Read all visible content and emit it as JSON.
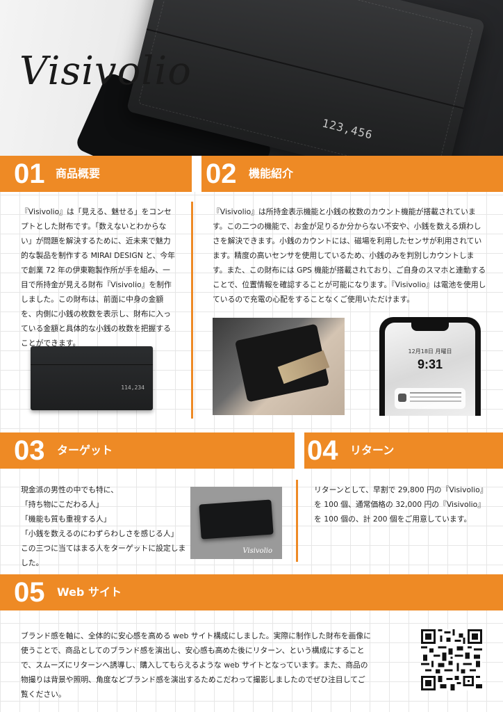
{
  "hero": {
    "logo": "Visivolio",
    "wallet_amount": "123,456"
  },
  "sections": [
    {
      "number": "01",
      "title": "商品概要",
      "body": "『Visivolio』は「見える、魅せる」をコンセプトとした財布です。「数えないとわからない」が問題を解決するために、近未来で魅力的な製品を制作する MIRAI DESIGN と、今年で創業 72 年の伊東鞄製作所が手を組み、一目で所持金が見える財布『Visivolio』を制作しました。この財布は、前面に中身の金額を、内側に小銭の枚数を表示し、財布に入っている金額と具体的な小銭の枚数を把握することができます。",
      "image_label": "114,234"
    },
    {
      "number": "02",
      "title": "機能紹介",
      "body": "『Visivolio』は所持金表示機能と小銭の枚数のカウント機能が搭載されています。この二つの機能で、お金が足りるか分からない不安や、小銭を数える煩わしさを解決できます。小銭のカウントには、磁場を利用したセンサが利用されています。精度の高いセンサを使用しているため、小銭のみを判別しカウントします。また、この財布には GPS 機能が搭載されており、ご自身のスマホと連動することで、位置情報を確認することが可能になります。『Visivolio』は電池を使用しているので充電の心配をすることなくご使用いただけます。",
      "phone": {
        "date": "12月18日 月曜日",
        "time": "9:31"
      }
    },
    {
      "number": "03",
      "title": "ターゲット",
      "lines": [
        "現金派の男性の中でも特に、",
        "「持ち物にこだわる人」",
        "「機能も質も重視する人」",
        "「小銭を数えるのにわずらわしさを感じる人」",
        "この三つに当てはまる人をターゲットに設定しました。"
      ],
      "image_script": "Visivolio"
    },
    {
      "number": "04",
      "title": "リターン",
      "body": "リターンとして、早割で 29,800 円の『Visivolio』を 100 個、通常価格の 32,000 円の『Visivolio』を 100 個の、計 200 個をご用意しています。"
    },
    {
      "number": "05",
      "title": "Web サイト",
      "body": "ブランド感を軸に、全体的に安心感を高める web サイト構成にしました。実際に制作した財布を画像に使うことで、商品としてのブランド感を演出し、安心感も高めた後にリターン、という構成にすることで、スムーズにリターンへ誘導し、購入してもらえるような web サイトとなっています。また、商品の物撮りは背景や照明、角度などブランド感を演出するためこだわって撮影しましたのでぜひ注目してご覧ください。"
    }
  ],
  "colors": {
    "accent": "#ee8a25",
    "text": "#222222"
  },
  "icons": {
    "qr": "qr-code-icon"
  }
}
